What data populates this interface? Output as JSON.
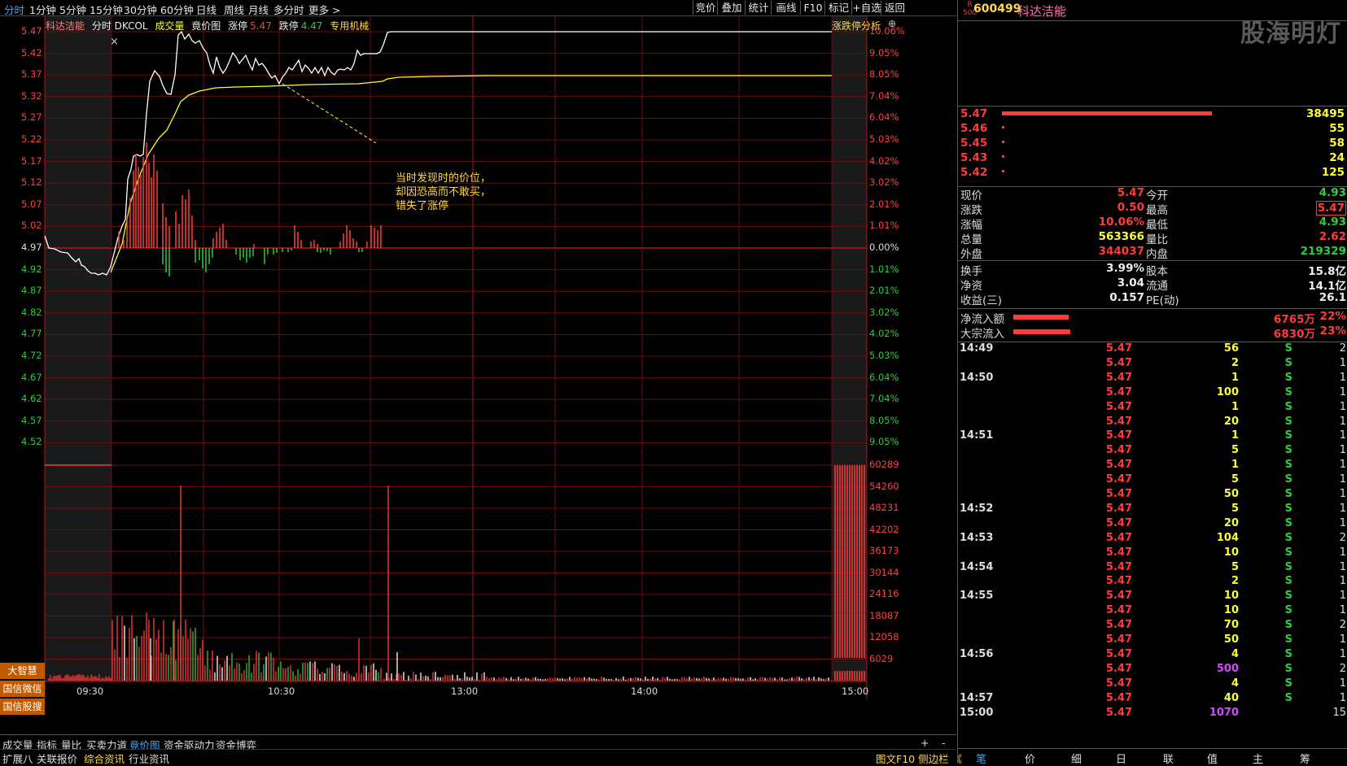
{
  "topbar": {
    "periods": [
      "分时",
      "1分钟",
      "5分钟",
      "15分钟",
      "30分钟",
      "60分钟",
      "日线",
      "周线",
      "月线",
      "多分时",
      "更多 >"
    ],
    "right_buttons": [
      "竞价",
      "叠加",
      "统计",
      "画线",
      "F10",
      "标记",
      "+自选",
      "返回"
    ]
  },
  "legend": {
    "name": "科达洁能",
    "mode": "分时 DKCOL",
    "volume": "成交量",
    "auction": "竟价图",
    "limit_up_label": "涨停",
    "limit_up": "5.47",
    "limit_down_label": "跌停",
    "limit_down": "4.47",
    "industry": "专用机械",
    "analysis": "涨跌停分析",
    "close_mark": "×",
    "plus_mark": "⊕"
  },
  "annotation": [
    "当时发现时的价位，",
    "却因恐高而不敢买，",
    "错失了涨停"
  ],
  "price_axis": [
    "5.47",
    "5.42",
    "5.37",
    "5.32",
    "5.27",
    "5.22",
    "5.17",
    "5.12",
    "5.07",
    "5.02",
    "4.97",
    "4.92",
    "4.87",
    "4.82",
    "4.77",
    "4.72",
    "4.67",
    "4.62",
    "4.57",
    "4.52"
  ],
  "pct_axis": [
    "10.06%",
    "9.05%",
    "8.05%",
    "7.04%",
    "6.04%",
    "5.03%",
    "4.02%",
    "3.02%",
    "2.01%",
    "1.01%",
    "0.00%",
    "1.01%",
    "2.01%",
    "3.02%",
    "4.02%",
    "5.03%",
    "6.04%",
    "7.04%",
    "8.05%",
    "9.05%"
  ],
  "vol_axis": [
    "60289",
    "54260",
    "48231",
    "42202",
    "36173",
    "30144",
    "24116",
    "18087",
    "12058",
    "6029"
  ],
  "time_axis": [
    "09:30",
    "10:30",
    "13:00",
    "14:00",
    "15:00"
  ],
  "left_badges": [
    "大智慧",
    "国信微信",
    "国信股搜"
  ],
  "bottom_tabs": [
    "成交量",
    "指标",
    "量比",
    "买卖力道",
    "竟价图",
    "资金驱动力",
    "资金博弈"
  ],
  "bottom_tabs_active": "竟价图",
  "bottom_controls": [
    "+",
    "-"
  ],
  "bottom_tabs2": [
    "扩展八",
    "关联报价",
    "综合资讯",
    "行业资讯"
  ],
  "bottom_right": "图文F10 侧边栏 《",
  "stock": {
    "badge_top": "R",
    "badge_bottom": "500",
    "code": "600499",
    "name": "科达洁能"
  },
  "watermark": "股海明灯",
  "orderbook": [
    {
      "price": "5.47",
      "vol": "38495",
      "bar": 1.0
    },
    {
      "price": "5.46",
      "vol": "55",
      "bar": 0.01
    },
    {
      "price": "5.45",
      "vol": "58",
      "bar": 0.01
    },
    {
      "price": "5.43",
      "vol": "24",
      "bar": 0.01
    },
    {
      "price": "5.42",
      "vol": "125",
      "bar": 0.01
    }
  ],
  "quote": [
    {
      "l1": "现价",
      "v1": "5.47",
      "l2": "今开",
      "v2": "4.93"
    },
    {
      "l1": "涨跌",
      "v1": "0.50",
      "l2": "最高",
      "v2": "5.47"
    },
    {
      "l1": "涨幅",
      "v1": "10.06%",
      "l2": "最低",
      "v2": "4.93"
    },
    {
      "l1": "总量",
      "v1": "563366",
      "l2": "量比",
      "v2": "2.62"
    },
    {
      "l1": "外盘",
      "v1": "344037",
      "l2": "内盘",
      "v2": "219329"
    }
  ],
  "quote2": [
    {
      "l1": "换手",
      "v1": "3.99%",
      "l2": "股本",
      "v2": "15.8亿"
    },
    {
      "l1": "净资",
      "v1": "3.04",
      "l2": "流通",
      "v2": "14.1亿"
    },
    {
      "l1": "收益(三)",
      "v1": "0.157",
      "l2": "PE(动)",
      "v2": "26.1"
    }
  ],
  "flows": [
    {
      "label": "净流入额",
      "amount": "6765万",
      "pct": "22%"
    },
    {
      "label": "大宗流入",
      "amount": "6830万",
      "pct": "23%"
    }
  ],
  "ticks": [
    {
      "time": "14:49",
      "price": "5.47",
      "vol": "56",
      "side": "S",
      "n": "2"
    },
    {
      "time": "",
      "price": "5.47",
      "vol": "2",
      "side": "S",
      "n": "1"
    },
    {
      "time": "14:50",
      "price": "5.47",
      "vol": "1",
      "side": "S",
      "n": "1"
    },
    {
      "time": "",
      "price": "5.47",
      "vol": "100",
      "side": "S",
      "n": "1"
    },
    {
      "time": "",
      "price": "5.47",
      "vol": "1",
      "side": "S",
      "n": "1"
    },
    {
      "time": "",
      "price": "5.47",
      "vol": "20",
      "side": "S",
      "n": "1"
    },
    {
      "time": "14:51",
      "price": "5.47",
      "vol": "1",
      "side": "S",
      "n": "1"
    },
    {
      "time": "",
      "price": "5.47",
      "vol": "5",
      "side": "S",
      "n": "1"
    },
    {
      "time": "",
      "price": "5.47",
      "vol": "1",
      "side": "S",
      "n": "1"
    },
    {
      "time": "",
      "price": "5.47",
      "vol": "5",
      "side": "S",
      "n": "1"
    },
    {
      "time": "",
      "price": "5.47",
      "vol": "50",
      "side": "S",
      "n": "1"
    },
    {
      "time": "14:52",
      "price": "5.47",
      "vol": "5",
      "side": "S",
      "n": "1"
    },
    {
      "time": "",
      "price": "5.47",
      "vol": "20",
      "side": "S",
      "n": "1"
    },
    {
      "time": "14:53",
      "price": "5.47",
      "vol": "104",
      "side": "S",
      "n": "2"
    },
    {
      "time": "",
      "price": "5.47",
      "vol": "10",
      "side": "S",
      "n": "1"
    },
    {
      "time": "14:54",
      "price": "5.47",
      "vol": "5",
      "side": "S",
      "n": "1"
    },
    {
      "time": "",
      "price": "5.47",
      "vol": "2",
      "side": "S",
      "n": "1"
    },
    {
      "time": "14:55",
      "price": "5.47",
      "vol": "10",
      "side": "S",
      "n": "1"
    },
    {
      "time": "",
      "price": "5.47",
      "vol": "10",
      "side": "S",
      "n": "1"
    },
    {
      "time": "",
      "price": "5.47",
      "vol": "70",
      "side": "S",
      "n": "2"
    },
    {
      "time": "",
      "price": "5.47",
      "vol": "50",
      "side": "S",
      "n": "1"
    },
    {
      "time": "14:56",
      "price": "5.47",
      "vol": "4",
      "side": "S",
      "n": "1"
    },
    {
      "time": "",
      "price": "5.47",
      "vol": "500",
      "side": "S",
      "n": "2",
      "big": true
    },
    {
      "time": "",
      "price": "5.47",
      "vol": "4",
      "side": "S",
      "n": "1"
    },
    {
      "time": "14:57",
      "price": "5.47",
      "vol": "40",
      "side": "S",
      "n": "1"
    },
    {
      "time": "15:00",
      "price": "5.47",
      "vol": "1070",
      "side": "",
      "n": "15",
      "big": true
    }
  ],
  "rp_bottom": [
    "笔",
    "价",
    "细",
    "日",
    "联",
    "值",
    "主",
    "筹"
  ],
  "colors": {
    "up": "#ff3c3c",
    "down": "#2ecc40",
    "price_line": "#ffffff",
    "avg_line": "#ffff33",
    "grid": "#7a0f0f",
    "accent": "#39a9ff"
  },
  "chart_data": {
    "type": "line",
    "title": "",
    "prev_close": 4.97,
    "ylim": [
      4.5,
      5.47
    ],
    "series": [
      {
        "name": "",
        "x": [
          "09:30",
          "09:36",
          "09:45",
          "09:50",
          "10:00",
          "10:05",
          "10:10",
          "10:20",
          "10:30",
          "10:40",
          "10:50",
          "11:00",
          "11:10",
          "11:20",
          "11:30",
          "14:00",
          "15:00"
        ],
        "values": [
          4.9,
          5.17,
          5.4,
          5.32,
          5.47,
          5.4,
          5.37,
          5.4,
          5.35,
          5.38,
          5.37,
          5.38,
          5.4,
          5.42,
          5.47,
          5.47,
          5.47
        ]
      },
      {
        "name": "",
        "values": [
          4.92,
          5.05,
          5.22,
          5.3,
          5.33,
          5.34,
          5.35,
          5.35,
          5.35,
          5.35,
          5.35,
          5.35,
          5.36,
          5.36,
          5.37,
          5.38,
          5.38
        ]
      }
    ]
  }
}
